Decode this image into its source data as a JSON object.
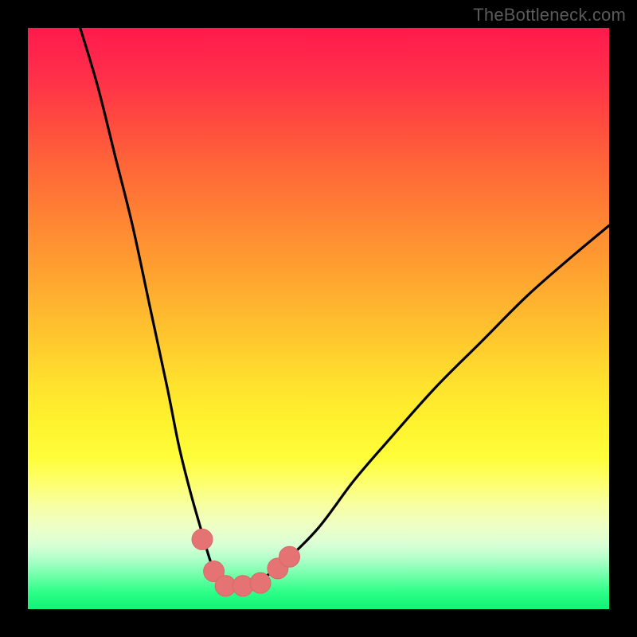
{
  "watermark": "TheBottleneck.com",
  "colors": {
    "frame": "#000000",
    "curve": "#000000",
    "marker_fill": "#e57373",
    "marker_stroke": "#d46a6a",
    "gradient_top": "#ff1a4d",
    "gradient_mid": "#ffe42e",
    "gradient_bottom": "#16f47a"
  },
  "chart_data": {
    "type": "line",
    "title": "",
    "xlabel": "",
    "ylabel": "",
    "xlim": [
      0,
      100
    ],
    "ylim": [
      0,
      100
    ],
    "grid": false,
    "series": [
      {
        "name": "bottleneck-curve",
        "x": [
          9,
          12,
          15,
          18,
          21,
          24,
          26,
          28,
          30,
          31.5,
          33,
          34.5,
          36,
          38,
          40,
          44,
          50,
          56,
          62,
          70,
          78,
          86,
          94,
          100
        ],
        "y": [
          100,
          90,
          78,
          66,
          52,
          38,
          28,
          20,
          13,
          8,
          5,
          4,
          4,
          4,
          5,
          8,
          14,
          22,
          29,
          38,
          46,
          54,
          61,
          66
        ]
      }
    ],
    "markers": [
      {
        "name": "marker-left-outer",
        "x": 30,
        "y": 12
      },
      {
        "name": "marker-left-inner",
        "x": 32,
        "y": 6.5
      },
      {
        "name": "marker-bottom-left",
        "x": 34,
        "y": 4
      },
      {
        "name": "marker-bottom-mid",
        "x": 37,
        "y": 4
      },
      {
        "name": "marker-bottom-right",
        "x": 40,
        "y": 4.5
      },
      {
        "name": "marker-right-inner",
        "x": 43,
        "y": 7
      },
      {
        "name": "marker-right-outer",
        "x": 45,
        "y": 9
      }
    ]
  }
}
